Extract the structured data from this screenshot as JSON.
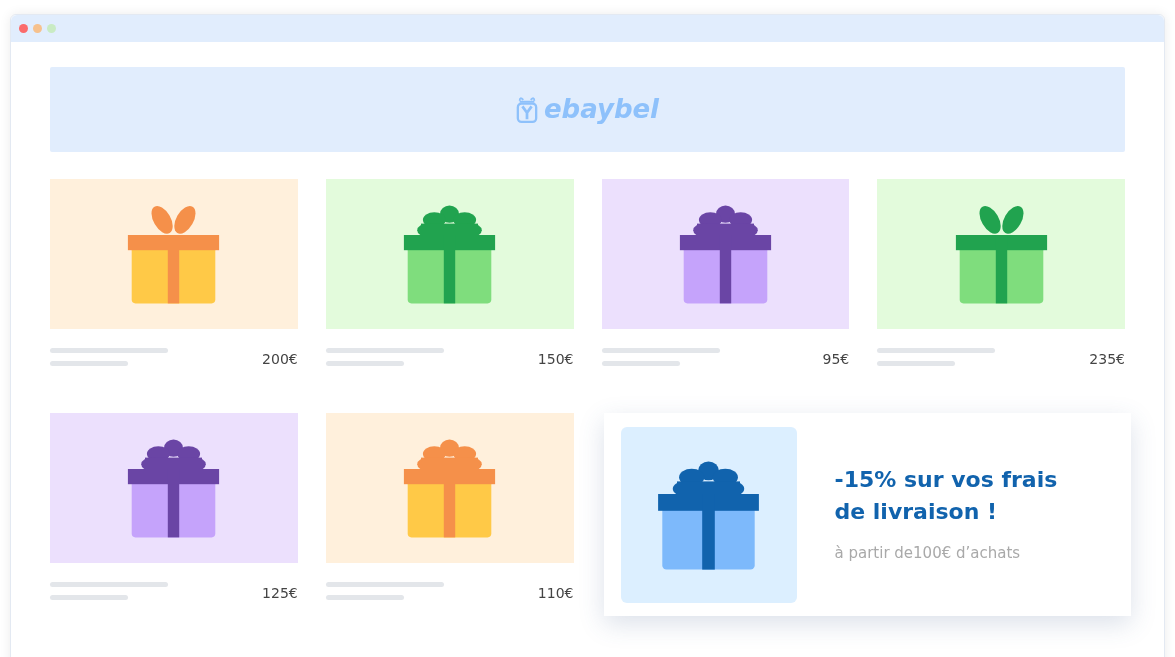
{
  "header": {
    "logo_text": "ebaybel"
  },
  "products": [
    {
      "color": "#f5904a",
      "kind": "loops",
      "price": "200€"
    },
    {
      "color": "#21a34f",
      "kind": "flower",
      "price": "150€"
    },
    {
      "color": "#6a45a5",
      "kind": "flower",
      "price": "95€"
    },
    {
      "color": "#21a34f",
      "kind": "loops",
      "price": "235€"
    },
    {
      "color": "#6a45a5",
      "kind": "flower",
      "price": "125€"
    },
    {
      "color": "#f5904a",
      "kind": "flower",
      "price": "110€"
    }
  ],
  "promo": {
    "color": "#1163ad",
    "kind": "flower",
    "title": "-15% sur vos frais de livraison !",
    "subtitle": "à partir de100€ d’achats"
  }
}
